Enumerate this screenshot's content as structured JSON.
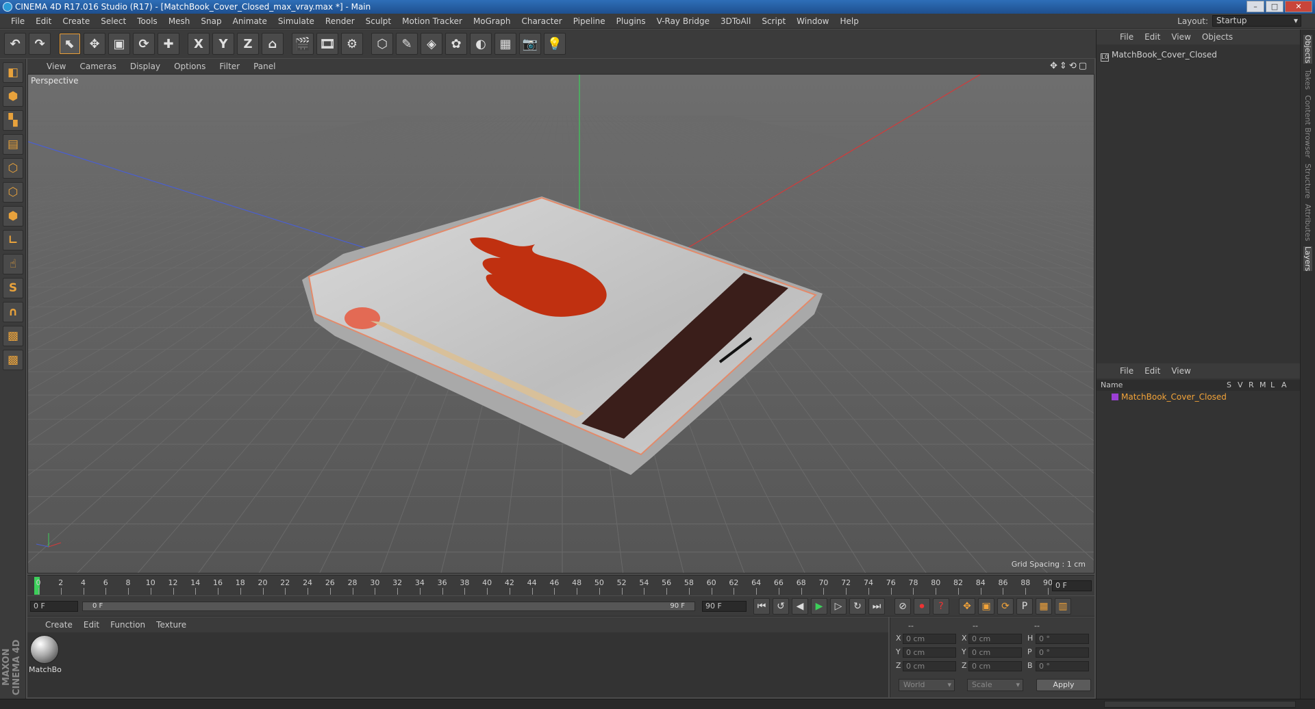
{
  "window": {
    "title": "CINEMA 4D R17.016 Studio (R17) - [MatchBook_Cover_Closed_max_vray.max *] - Main",
    "buttons": [
      "–",
      "□",
      "✕"
    ]
  },
  "menubar": {
    "items": [
      "File",
      "Edit",
      "Create",
      "Select",
      "Tools",
      "Mesh",
      "Snap",
      "Animate",
      "Simulate",
      "Render",
      "Sculpt",
      "Motion Tracker",
      "MoGraph",
      "Character",
      "Pipeline",
      "Plugins",
      "V-Ray Bridge",
      "3DToAll",
      "Script",
      "Window",
      "Help"
    ],
    "layout_label": "Layout:",
    "layout_value": "Startup"
  },
  "toolbar": {
    "buttons": [
      {
        "name": "undo-button",
        "glyph": "↶"
      },
      {
        "name": "redo-button",
        "glyph": "↷"
      },
      {
        "name": "live-selection-button",
        "glyph": "⬉"
      },
      {
        "name": "move-button",
        "glyph": "✥"
      },
      {
        "name": "scale-button",
        "glyph": "▣"
      },
      {
        "name": "rotate-button",
        "glyph": "⟳"
      },
      {
        "name": "recent-tools-button",
        "glyph": "✚"
      },
      {
        "name": "x-axis-button",
        "glyph": "X"
      },
      {
        "name": "y-axis-button",
        "glyph": "Y"
      },
      {
        "name": "z-axis-button",
        "glyph": "Z"
      },
      {
        "name": "coordinate-system-button",
        "glyph": "⌂"
      },
      {
        "name": "render-view-button",
        "glyph": "🎬"
      },
      {
        "name": "render-picture-viewer-button",
        "glyph": "🎞"
      },
      {
        "name": "render-settings-button",
        "glyph": "⚙"
      },
      {
        "name": "cube-button",
        "glyph": "⬡"
      },
      {
        "name": "pen-button",
        "glyph": "✎"
      },
      {
        "name": "subdivision-button",
        "glyph": "◈"
      },
      {
        "name": "cloner-button",
        "glyph": "✿"
      },
      {
        "name": "deformer-button",
        "glyph": "◐"
      },
      {
        "name": "floor-button",
        "glyph": "▦"
      },
      {
        "name": "camera-button",
        "glyph": "📷"
      },
      {
        "name": "light-button",
        "glyph": "💡"
      }
    ]
  },
  "lefttools": {
    "buttons": [
      {
        "name": "make-editable-button",
        "glyph": "◧"
      },
      {
        "name": "model-mode-button",
        "glyph": "⬢"
      },
      {
        "name": "texture-mode-button",
        "glyph": "▚"
      },
      {
        "name": "workplane-button",
        "glyph": "▤"
      },
      {
        "name": "points-mode-button",
        "glyph": "⬡"
      },
      {
        "name": "edges-mode-button",
        "glyph": "⬡"
      },
      {
        "name": "polygons-mode-button",
        "glyph": "⬢"
      },
      {
        "name": "axis-mode-button",
        "glyph": "∟"
      },
      {
        "name": "tweak-mode-button",
        "glyph": "☝"
      },
      {
        "name": "snap-button",
        "glyph": "S"
      },
      {
        "name": "magnet-button",
        "glyph": "∩"
      },
      {
        "name": "grid-lock-button",
        "glyph": "▩"
      },
      {
        "name": "solo-button",
        "glyph": "▩"
      }
    ],
    "brand": "MAXON CINEMA 4D"
  },
  "viewport": {
    "menu": [
      "View",
      "Cameras",
      "Display",
      "Options",
      "Filter",
      "Panel"
    ],
    "nav_glyphs": "✥⇕⟲▢",
    "label": "Perspective",
    "grid_spacing": "Grid Spacing : 1 cm"
  },
  "timeline": {
    "ticks": [
      0,
      2,
      4,
      6,
      8,
      10,
      12,
      14,
      16,
      18,
      20,
      22,
      24,
      26,
      28,
      30,
      32,
      34,
      36,
      38,
      40,
      42,
      44,
      46,
      48,
      50,
      52,
      54,
      56,
      58,
      60,
      62,
      64,
      66,
      68,
      70,
      72,
      74,
      76,
      78,
      80,
      82,
      84,
      86,
      88,
      90
    ],
    "current_frame": "0 F"
  },
  "transport": {
    "start_field": "0 F",
    "range_start": "0 F",
    "range_end": "90 F",
    "end_field": "90 F",
    "buttons": [
      {
        "name": "go-to-start-button",
        "glyph": "⏮",
        "cls": ""
      },
      {
        "name": "previous-keyframe-button",
        "glyph": "↺",
        "cls": ""
      },
      {
        "name": "previous-frame-button",
        "glyph": "◀",
        "cls": ""
      },
      {
        "name": "play-button",
        "glyph": "▶",
        "cls": "play"
      },
      {
        "name": "next-frame-button",
        "glyph": "▷",
        "cls": ""
      },
      {
        "name": "next-keyframe-button",
        "glyph": "↻",
        "cls": ""
      },
      {
        "name": "go-to-end-button",
        "glyph": "⏭",
        "cls": ""
      },
      {
        "name": "record-disabled-button",
        "glyph": "⊘",
        "cls": ""
      },
      {
        "name": "record-button",
        "glyph": "⏺",
        "cls": "red"
      },
      {
        "name": "autokey-button",
        "glyph": "?",
        "cls": "red"
      },
      {
        "name": "key-position-button",
        "glyph": "✥",
        "cls": "orange"
      },
      {
        "name": "key-scale-button",
        "glyph": "▣",
        "cls": "orange"
      },
      {
        "name": "key-rotation-button",
        "glyph": "⟳",
        "cls": "orange"
      },
      {
        "name": "key-parameter-button",
        "glyph": "P",
        "cls": ""
      },
      {
        "name": "key-pla-button",
        "glyph": "▦",
        "cls": "orange"
      },
      {
        "name": "timeline-window-button",
        "glyph": "▥",
        "cls": "orange"
      }
    ]
  },
  "material_manager": {
    "menu": [
      "Create",
      "Edit",
      "Function",
      "Texture"
    ],
    "material_label": "MatchBo"
  },
  "coordinates": {
    "headers": [
      "--",
      "--",
      "--"
    ],
    "rows": [
      {
        "axis": "X",
        "pos": "0 cm",
        "axis2": "X",
        "size": "0 cm",
        "rot_label": "H",
        "rot": "0 °"
      },
      {
        "axis": "Y",
        "pos": "0 cm",
        "axis2": "Y",
        "size": "0 cm",
        "rot_label": "P",
        "rot": "0 °"
      },
      {
        "axis": "Z",
        "pos": "0 cm",
        "axis2": "Z",
        "size": "0 cm",
        "rot_label": "B",
        "rot": "0 °"
      }
    ],
    "space": "World",
    "mode": "Scale",
    "apply": "Apply"
  },
  "object_manager": {
    "menu": [
      "File",
      "Edit",
      "View",
      "Objects"
    ],
    "object_name": "MatchBook_Cover_Closed"
  },
  "layer_manager": {
    "menu": [
      "File",
      "Edit",
      "View"
    ],
    "columns": [
      "Name",
      "S",
      "V",
      "R",
      "M",
      "L",
      "A"
    ],
    "layer_name": "MatchBook_Cover_Closed"
  },
  "side_tabs": [
    "Objects",
    "Takes",
    "Content Browser",
    "Structure",
    "Attributes",
    "Layers"
  ],
  "colors": {
    "accent": "#f2a339",
    "playhead": "#3ccf5a",
    "layer_color": "#9b3fd4",
    "x_axis": "#d33a3a",
    "y_axis": "#3ccf5a",
    "z_axis": "#4a5fd0"
  }
}
